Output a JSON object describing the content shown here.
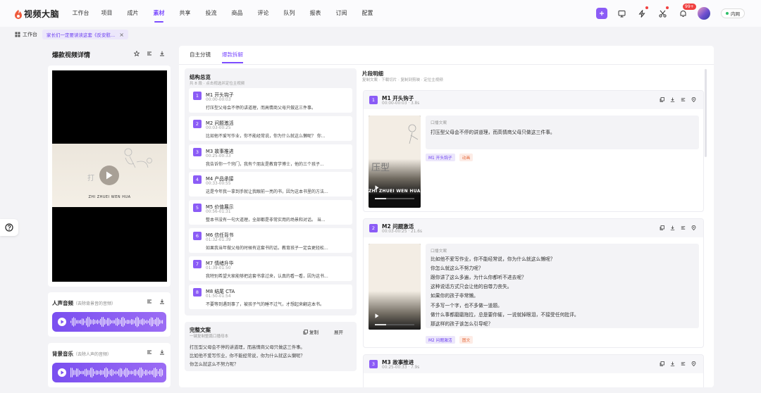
{
  "app": {
    "name": "视频大脑"
  },
  "nav": {
    "items": [
      "工作台",
      "项目",
      "成片",
      "素材",
      "共享",
      "投流",
      "商品",
      "评论",
      "队列",
      "报表",
      "订阅",
      "配置"
    ],
    "active_index": 3,
    "notification_badge": "99+",
    "network_label": "内网"
  },
  "tabs": {
    "workbench_label": "工作台",
    "open_tab_label": "家长们一定要读读这套《反安慰..."
  },
  "left": {
    "title": "爆款视频详情",
    "video_caption": "ZHI ZHUEI WEN HUA",
    "vocal": {
      "title": "人声音频",
      "hint": "（去除背景音的音频）"
    },
    "bgm": {
      "title": "背景音乐",
      "hint": "（去除人声的音频）"
    }
  },
  "main": {
    "tabs": [
      "自主分镜",
      "爆款拆解"
    ],
    "active_tab": 1,
    "structure": {
      "title": "结构总览",
      "subtitle": "共 8 段 · 点击视选并定位主视频",
      "segments": [
        {
          "num": "1",
          "title": "M1 开头钩子",
          "time": "00:00-00:03",
          "desc": "打压型父母会不停的讲道理，而高情商父母只做这三件事。"
        },
        {
          "num": "2",
          "title": "M2 问题激活",
          "time": "00:03-00:25",
          "desc": "比如他不爱写作业，你不能经常说，你为什么就这么懒呢？ 你..."
        },
        {
          "num": "3",
          "title": "M3 故事推进",
          "time": "00:25-00:33",
          "desc": "我告诉你一个窍门，我有个朋友是教育学博士，他的三个孩子..."
        },
        {
          "num": "4",
          "title": "M4 产品承接",
          "time": "00:33-00:55",
          "desc": "这是今年我一拿到手就让我眼前一亮的书，因为这本书里的方法..."
        },
        {
          "num": "5",
          "title": "M5 价值展示",
          "time": "00:56-01:31",
          "desc": "整本书没有一句大道理，全部都是非常实用的场景和对话。 当..."
        },
        {
          "num": "6",
          "title": "M6 信任背书",
          "time": "01:32-01:39",
          "desc": "如果我当年做父母的时候有这套书的话，教育孩子一定会更轻松..."
        },
        {
          "num": "7",
          "title": "M7 情绪升华",
          "time": "01:39-01:50",
          "desc": "我特别希望大家能够把这套书拿过来，认真的看一看，因为这书..."
        },
        {
          "num": "8",
          "title": "M8 结尾 CTA",
          "time": "01:50-01:54",
          "desc": "不要等到遇到事了，被孩子气的睡不过气，才想起来翻这本书。"
        }
      ]
    },
    "full_text": {
      "title": "完整文案",
      "subtitle": "一键复制整篇口播母本",
      "copy_label": "复制",
      "expand_label": "展开",
      "lines": [
        "打压型父母会不停的讲道理，而高情商父母只做这三件事。",
        "比如他不爱写作业，你不能经常说，你为什么就这么懒呢？",
        "你怎么就这么不努力呢？"
      ]
    },
    "detail": {
      "title": "片段明细",
      "subtitle": "复制文案 · 下载切片 · 复制到剪映 · 定位主视频",
      "text_label": "口播文案",
      "cards": [
        {
          "num": "1",
          "title": "M1 开头钩子",
          "meta": "00:00-00:03 · 3.8s",
          "lines": [
            "打压型父母会不停的讲道理，而高情商父母只做这三件事。"
          ],
          "tags": [
            "M1 开头钩子",
            "动画"
          ],
          "thumb_text": "ZHI ZHUEI WEN HUA"
        },
        {
          "num": "2",
          "title": "M2 问题激活",
          "meta": "00:03-00:25 · 21.6s",
          "lines": [
            "比如他不爱写作业，你不能经常说，你为什么就这么懒呢？",
            "你怎么就这么不努力呢？",
            "跟你讲了这么多遍，为什么你都听不进去呢？",
            "这种说话方式只会让他的自尊力丧失。",
            "如果你的孩子非常懒。",
            "不多写一个字，也不多做一道题。",
            "做什么事都磨磨拖拉，总是要你催，一说就掉眼泪，不接受任何批评。",
            "那这样的孩子该怎么引导呢？"
          ],
          "tags": [
            "M2 问题激活",
            "图文"
          ],
          "thumb_text": ""
        },
        {
          "num": "3",
          "title": "M3 故事推进",
          "meta": "00:25-00:33 · 7.9s"
        }
      ]
    }
  },
  "colors": {
    "accent": "#7c4dff",
    "badge": "#f04040",
    "online": "#2fbf6a"
  },
  "icons": [
    "logo-icon",
    "plus-icon",
    "screen-icon",
    "flash-icon",
    "scissors-icon",
    "bell-icon",
    "star-icon",
    "trim-icon",
    "download-icon",
    "play-icon",
    "copy-icon",
    "locate-icon",
    "help-icon",
    "home-icon",
    "close-icon"
  ]
}
